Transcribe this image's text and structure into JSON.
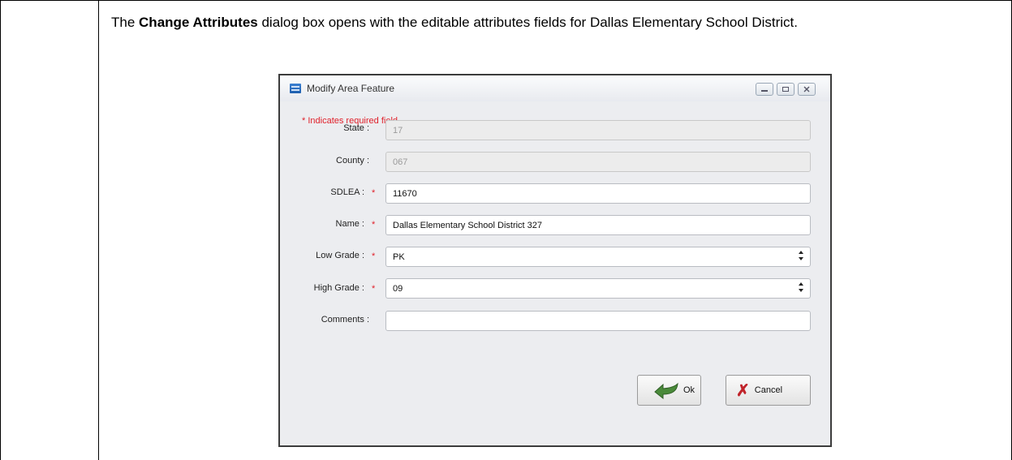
{
  "document": {
    "text_before": "The ",
    "text_bold": "Change Attributes",
    "text_after": " dialog box opens with the editable attributes fields for Dallas Elementary School District."
  },
  "dialog": {
    "title": "Modify Area Feature",
    "required_note": "* Indicates required field",
    "fields": {
      "state": {
        "label": "State :",
        "value": "17"
      },
      "county": {
        "label": "County :",
        "value": "067"
      },
      "sdlea": {
        "label": "SDLEA :",
        "value": "11670",
        "required_mark": "*"
      },
      "name": {
        "label": "Name :",
        "value": "Dallas Elementary School District 327",
        "required_mark": "*"
      },
      "low_grade": {
        "label": "Low Grade :",
        "value": "PK",
        "required_mark": "*"
      },
      "high_grade": {
        "label": "High Grade :",
        "value": "09",
        "required_mark": "*"
      },
      "comments": {
        "label": "Comments :",
        "value": ""
      }
    },
    "buttons": {
      "ok": "Ok",
      "cancel": "Cancel"
    },
    "icons": {
      "app": "app-icon",
      "minimize": "minimize-icon",
      "restore": "restore-icon",
      "close": "close-icon",
      "ok": "ok-arrow-icon",
      "cancel": "cancel-x-icon",
      "select_arrow": "updown-arrow-icon"
    },
    "colors": {
      "required": "#e0202a",
      "ok_icon": "#4a8a3a",
      "cancel_icon": "#c0242b"
    }
  }
}
